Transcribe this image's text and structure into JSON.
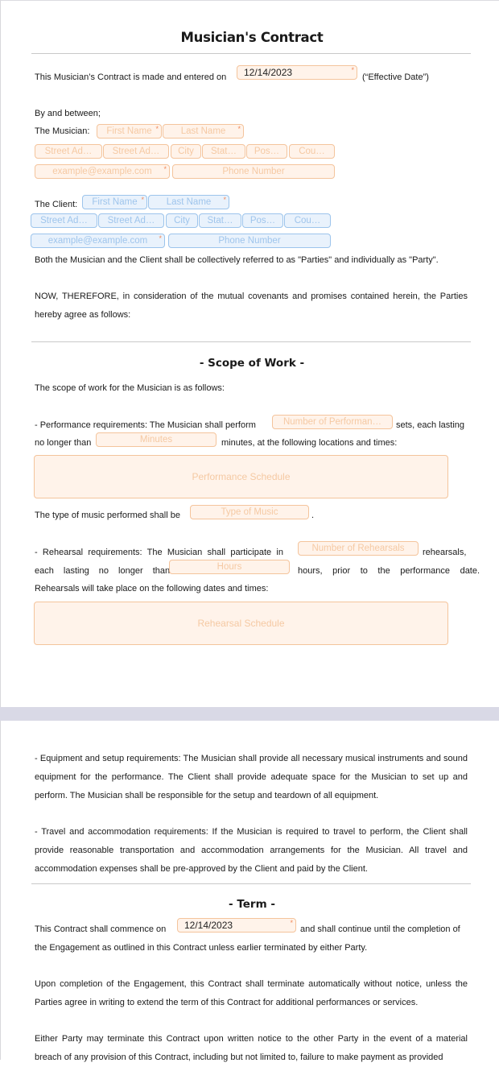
{
  "document": {
    "title": "Musician's Contract",
    "intro": {
      "prefix": "This Musician’s Contract is made and entered on",
      "effective_date": "12/14/2023",
      "suffix": "(“Effective Date”)"
    },
    "by_and_between": "By and between;",
    "musician": {
      "label": "The Musician:",
      "first_name_placeholder": "First Name",
      "last_name_placeholder": "Last Name",
      "street1_placeholder": "Street Ad…",
      "street2_placeholder": "Street Ad…",
      "city_placeholder": "City",
      "state_placeholder": "Stat…",
      "postal_placeholder": "Pos…",
      "country_placeholder": "Cou…",
      "email_placeholder": "example@example.com",
      "phone_placeholder": "Phone Number"
    },
    "client": {
      "label": "The Client:",
      "first_name_placeholder": "First Name",
      "last_name_placeholder": "Last Name",
      "street1_placeholder": "Street Ad…",
      "street2_placeholder": "Street Ad…",
      "city_placeholder": "City",
      "state_placeholder": "Stat…",
      "postal_placeholder": "Pos…",
      "country_placeholder": "Cou…",
      "email_placeholder": "example@example.com",
      "phone_placeholder": "Phone Number"
    },
    "required_marker": "*",
    "parties_text": "Both the Musician and the Client shall be collectively referred to as \"Parties\" and individually as \"Party\".",
    "now_therefore": "NOW, THEREFORE, in consideration of the mutual covenants and promises contained herein, the Parties hereby agree as follows:",
    "scope": {
      "heading": "- Scope of Work -",
      "intro": "The scope of work for the Musician is as follows:",
      "perf_line1_prefix": "- Performance requirements: The Musician shall perform",
      "perf_sets_placeholder": "Number of Performan…",
      "perf_line1_suffix": "sets, each lasting",
      "perf_line2_prefix": "no longer than",
      "perf_minutes_placeholder": "Minutes",
      "perf_line2_suffix": "minutes, at the following locations and times:",
      "perf_schedule_placeholder": "Performance Schedule",
      "music_type_prefix": "The type of music performed shall be",
      "music_type_placeholder": "Type of Music",
      "music_type_suffix": ".",
      "reh_line1_prefix": "- Rehearsal requirements: The Musician shall participate in",
      "reh_count_placeholder": "Number of Rehearsals",
      "reh_line1_suffix": "rehearsals,",
      "reh_line2_prefix": "each lasting no longer than",
      "reh_hours_placeholder": "Hours",
      "reh_line2_suffix": "hours, prior to the performance date.",
      "reh_line3": "Rehearsals will take place on the following dates and times:",
      "reh_schedule_placeholder": "Rehearsal Schedule",
      "equipment": "- Equipment and setup requirements: The Musician shall provide all necessary musical instruments and sound equipment for the performance. The Client shall provide adequate space for the Musician to set up and perform. The Musician shall be responsible for the setup and teardown of all equipment.",
      "travel": "- Travel and accommodation requirements: If the Musician is required to travel to perform, the Client shall provide reasonable transportation and accommodation arrangements for the Musician. All travel and accommodation expenses shall be pre-approved by the Client and paid by the Client."
    },
    "term": {
      "heading": "- Term -",
      "commence_prefix": "This Contract shall commence on",
      "commence_date": "12/14/2023",
      "commence_suffix": "and shall continue until the completion of",
      "commence_line2": "the Engagement as outlined in this Contract unless earlier terminated by either Party.",
      "completion": "Upon completion of the Engagement, this Contract shall terminate automatically without notice, unless the Parties agree in writing to extend the term of this Contract for additional performances or services.",
      "termination": "Either Party may terminate this Contract upon written notice to the other Party in the event of a material breach of any provision of this Contract, including but not limited to, failure to make payment as provided"
    }
  },
  "colors": {
    "musician_field_border": "#f4c49c",
    "musician_field_bg": "#fff3ea",
    "client_field_border": "#9cc4ec",
    "client_field_bg": "#e9f2fc",
    "required_marker": "#f08a5d",
    "page_gap": "#d9d9e6"
  }
}
